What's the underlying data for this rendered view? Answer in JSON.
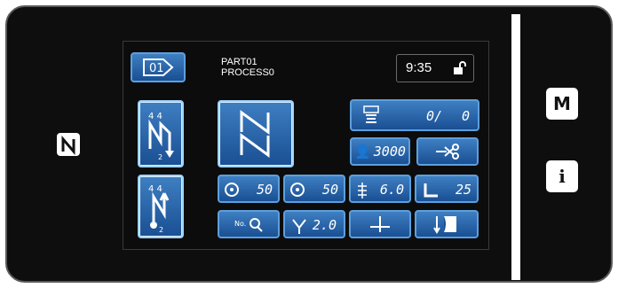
{
  "header": {
    "program_number": "01",
    "part": "PART01",
    "process": "PROCESS0",
    "time": "9:35"
  },
  "counter": {
    "value": "0/",
    "total": "0"
  },
  "speed": {
    "value": "3000"
  },
  "thread_tension": {
    "left": "50",
    "right": "50"
  },
  "stitch_pitch": {
    "value": "6.0",
    "dual": "2.0"
  },
  "presser_height": {
    "value": "25"
  },
  "side_buttons": {
    "m_label": "M",
    "i_label": "i"
  },
  "colors": {
    "button_top": "#3e7fc2",
    "button_bottom": "#1a4f93",
    "button_border": "#5d9fdd",
    "screen_bg": "#0c0c0c"
  },
  "icons": [
    "nfc-icon",
    "lock-open-icon",
    "bobbin-counter-icon",
    "operator-icon",
    "thread-trimmer-icon",
    "tension-left-icon",
    "tension-right-icon",
    "stitch-length-icon",
    "presser-foot-icon",
    "pattern-search-icon",
    "dual-stitch-icon",
    "needle-position-icon",
    "thread-guide-icon",
    "backtack-start-icon",
    "backtack-end-icon",
    "pattern-zigzag-icon"
  ]
}
